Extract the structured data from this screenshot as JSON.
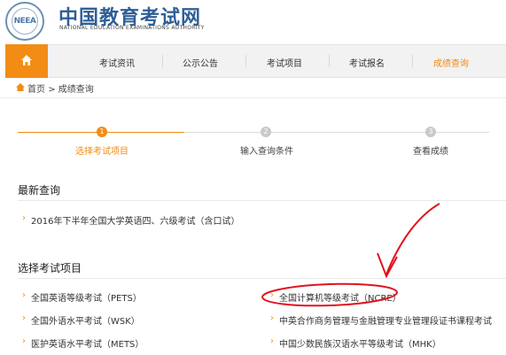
{
  "header": {
    "emblem_text": "NEEA",
    "title": "中国教育考试网",
    "subtitle": "NATIONAL EDUCATION EXAMINATIONS AUTHORITY"
  },
  "nav": {
    "items": [
      "考试资讯",
      "公示公告",
      "考试项目",
      "考试报名",
      "成绩查询"
    ],
    "active_index": 4
  },
  "breadcrumb": {
    "home": "首页",
    "separator": ">",
    "current": "成绩查询"
  },
  "steps": [
    {
      "number": "1",
      "label": "选择考试项目",
      "active": true
    },
    {
      "number": "2",
      "label": "输入查询条件",
      "active": false
    },
    {
      "number": "3",
      "label": "查看成绩",
      "active": false
    }
  ],
  "latest": {
    "title": "最新查询",
    "items": [
      "2016年下半年全国大学英语四、六级考试（含口试）"
    ]
  },
  "select_exam": {
    "title": "选择考试项目",
    "left": [
      "全国英语等级考试（PETS）",
      "全国外语水平考试（WSK）",
      "医护英语水平考试（METS）"
    ],
    "right": [
      "全国计算机等级考试（NCRE）",
      "中英合作商务管理与金融管理专业管理段证书课程考试",
      "中国少数民族汉语水平等级考试（MHK）"
    ]
  },
  "colors": {
    "accent": "#f28c14",
    "brand": "#2f5f96",
    "annotation": "#e0141e"
  }
}
